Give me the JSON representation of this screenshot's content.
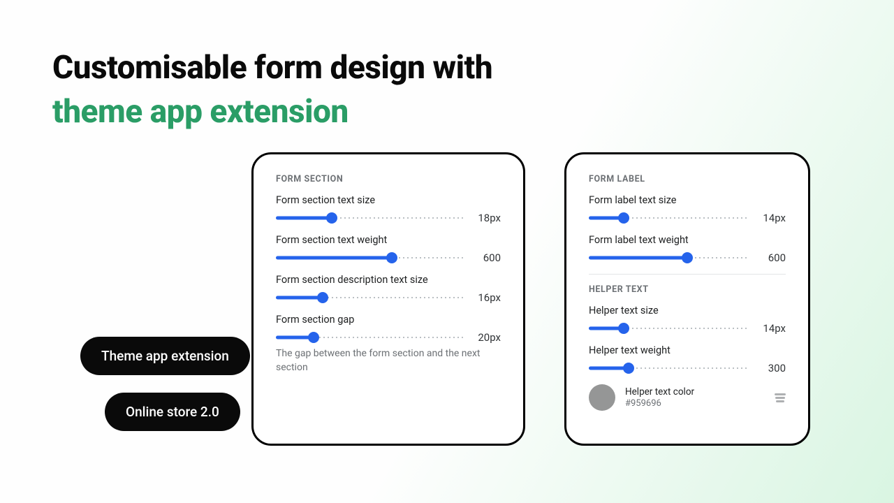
{
  "headline": {
    "line1": "Customisable form design with",
    "line2": "theme app extension"
  },
  "pills": {
    "theme": "Theme app extension",
    "store": "Online store 2.0"
  },
  "left": {
    "section_title": "FORM SECTION",
    "controls": [
      {
        "label": "Form section text size",
        "value": "18px",
        "pct": 30
      },
      {
        "label": "Form section text weight",
        "value": "600",
        "pct": 62
      },
      {
        "label": "Form section description text size",
        "value": "16px",
        "pct": 25
      },
      {
        "label": "Form section gap",
        "value": "20px",
        "pct": 20,
        "help": "The gap between the form section and the next section"
      }
    ]
  },
  "right": {
    "section1_title": "FORM LABEL",
    "section1_controls": [
      {
        "label": "Form label text size",
        "value": "14px",
        "pct": 22
      },
      {
        "label": "Form label text weight",
        "value": "600",
        "pct": 62
      }
    ],
    "section2_title": "HELPER TEXT",
    "section2_controls": [
      {
        "label": "Helper text size",
        "value": "14px",
        "pct": 22
      },
      {
        "label": "Helper text weight",
        "value": "300",
        "pct": 25
      }
    ],
    "color": {
      "label": "Helper text color",
      "hex": "#959696"
    }
  }
}
